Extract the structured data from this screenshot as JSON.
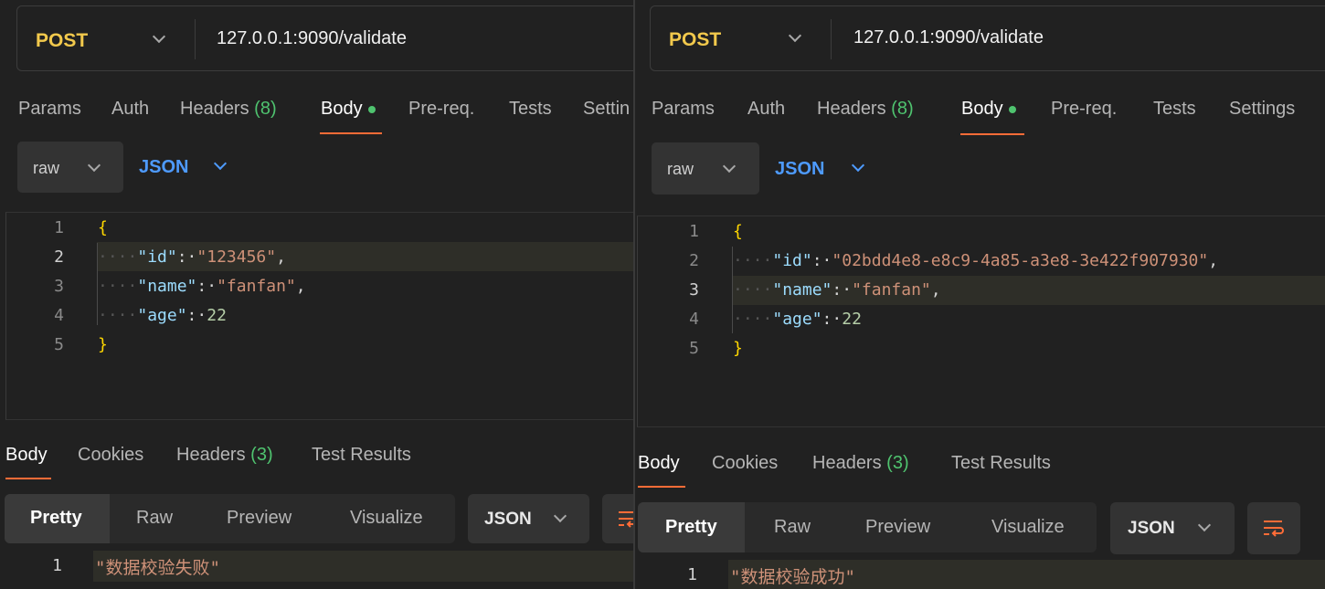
{
  "panels": [
    {
      "method": "POST",
      "url": "127.0.0.1:9090/validate",
      "request_tabs": [
        {
          "label": "Params"
        },
        {
          "label": "Auth"
        },
        {
          "label": "Headers",
          "count": "(8)"
        },
        {
          "label": "Body",
          "active": true
        },
        {
          "label": "Pre-req."
        },
        {
          "label": "Tests"
        },
        {
          "label": "Settin"
        }
      ],
      "body_mode": "raw",
      "body_language": "JSON",
      "code_lines": [
        {
          "n": "1",
          "text": "{"
        },
        {
          "n": "2",
          "key": "\"id\"",
          "value": "\"123456\"",
          "type": "str",
          "comma": ","
        },
        {
          "n": "3",
          "key": "\"name\"",
          "value": "\"fanfan\"",
          "type": "str",
          "comma": ","
        },
        {
          "n": "4",
          "key": "\"age\"",
          "value": "22",
          "type": "num",
          "comma": ""
        },
        {
          "n": "5",
          "text": "}"
        }
      ],
      "response_tabs": [
        {
          "label": "Body",
          "active": true
        },
        {
          "label": "Cookies"
        },
        {
          "label": "Headers",
          "count": "(3)"
        },
        {
          "label": "Test Results"
        }
      ],
      "view_tabs": [
        "Pretty",
        "Raw",
        "Preview",
        "Visualize"
      ],
      "response_format": "JSON",
      "response_line_number": "1",
      "response_text": "\"数据校验失败\""
    },
    {
      "method": "POST",
      "url": "127.0.0.1:9090/validate",
      "request_tabs": [
        {
          "label": "Params"
        },
        {
          "label": "Auth"
        },
        {
          "label": "Headers",
          "count": "(8)"
        },
        {
          "label": "Body",
          "active": true
        },
        {
          "label": "Pre-req."
        },
        {
          "label": "Tests"
        },
        {
          "label": "Settings"
        }
      ],
      "body_mode": "raw",
      "body_language": "JSON",
      "code_lines": [
        {
          "n": "1",
          "text": "{"
        },
        {
          "n": "2",
          "key": "\"id\"",
          "value": "\"02bdd4e8-e8c9-4a85-a3e8-3e422f907930\"",
          "type": "str",
          "comma": ","
        },
        {
          "n": "3",
          "key": "\"name\"",
          "value": "\"fanfan\"",
          "type": "str",
          "comma": ","
        },
        {
          "n": "4",
          "key": "\"age\"",
          "value": "22",
          "type": "num",
          "comma": ""
        },
        {
          "n": "5",
          "text": "}"
        }
      ],
      "response_tabs": [
        {
          "label": "Body",
          "active": true
        },
        {
          "label": "Cookies"
        },
        {
          "label": "Headers",
          "count": "(3)"
        },
        {
          "label": "Test Results"
        }
      ],
      "view_tabs": [
        "Pretty",
        "Raw",
        "Preview",
        "Visualize"
      ],
      "response_format": "JSON",
      "response_line_number": "1",
      "response_text": "\"数据校验成功\""
    }
  ],
  "icons": {
    "method_dropdown": "chevron-down-icon",
    "body_status": "green-dot-icon",
    "wrap": "wrap-lines-icon"
  },
  "colors": {
    "background": "#212121",
    "method": "#f2c94c",
    "accent_underline": "#ff6c37",
    "count_green": "#4fc36f",
    "json_blue": "#4e9bff",
    "json_key": "#9cdcfe",
    "json_string": "#ce9178",
    "json_number": "#b5cea8"
  }
}
